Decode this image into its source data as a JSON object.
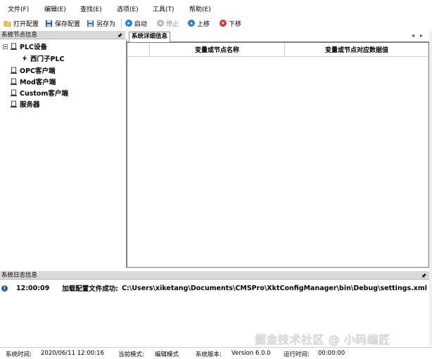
{
  "menu": [
    "文件(F)",
    "编辑(E)",
    "查找(E)",
    "选项(E)",
    "工具(T)",
    "帮助(E)"
  ],
  "toolbar": {
    "open": "打开配置",
    "save": "保存配置",
    "save_as": "另存为",
    "start": "启动",
    "stop": "停止",
    "up": "上移",
    "down": "下移"
  },
  "left_panel": {
    "title": "系统节点信息",
    "tree": {
      "plc": "PLC设备",
      "siemens": "西门子PLC",
      "opc": "OPC客户端",
      "mod": "Mod客户端",
      "custom": "Custom客户端",
      "server": "服务器"
    }
  },
  "right_panel": {
    "tab": "系统详细信息",
    "columns": [
      "变量或节点名称",
      "变量或节点对应数据值"
    ]
  },
  "log_panel": {
    "title": "系统日志信息",
    "entry": {
      "time": "12:00:09",
      "message": "加载配置文件成功:",
      "path": "C:\\Users\\xiketang\\Documents\\CMSPro\\XktConfigManager\\bin\\Debug\\settings.xml"
    }
  },
  "watermark": "掘金技术社区 @ 小码编匠",
  "status": {
    "time_label": "系统时间:",
    "time_value": "2020/06/11 12:00:16",
    "mode_label": "当前模式:",
    "mode_value": "编辑模式",
    "version_label": "系统版本:",
    "version_value": "Version  6.0.0",
    "run_label": "运行时间:",
    "run_value": "00:00:00"
  },
  "colors": {
    "accent_blue": "#1e7fd1",
    "stop_red": "#d23a3a",
    "disabled_gray": "#8a8a8a",
    "panel_header": "#d9d9d9"
  }
}
